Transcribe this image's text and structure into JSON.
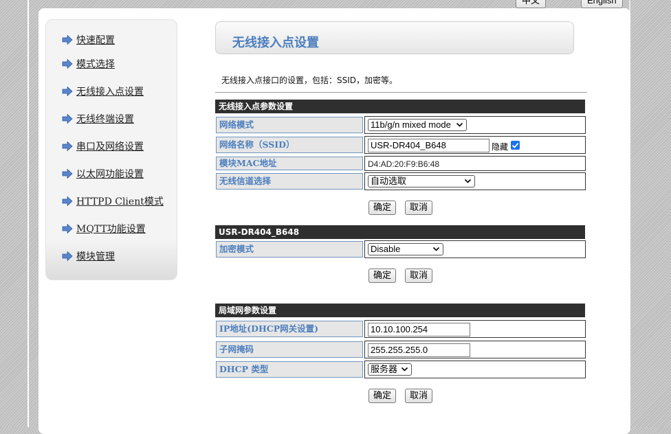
{
  "header": {
    "lang_zh": "中文",
    "lang_en": "English"
  },
  "menu": {
    "items": [
      {
        "label": "快速配置"
      },
      {
        "label": "模式选择"
      },
      {
        "label": "无线接入点设置"
      },
      {
        "label": "无线终端设置"
      },
      {
        "label": "串口及网络设置"
      },
      {
        "label": "以太网功能设置"
      },
      {
        "label": "HTTPD Client模式"
      },
      {
        "label": "MQTT功能设置"
      },
      {
        "label": "模块管理"
      }
    ]
  },
  "page": {
    "title": "无线接入点设置",
    "description": "无线接入点接口的设置，包括：SSID，加密等。"
  },
  "ap_section": {
    "header": "无线接入点参数设置",
    "network_mode": {
      "label": "网络模式",
      "value": "11b/g/n mixed mode"
    },
    "ssid": {
      "label": "网络名称（SSID）",
      "value": "USR-DR404_B648",
      "hide_label": "隐藏",
      "hide_checked": true
    },
    "mac": {
      "label": "模块MAC地址",
      "value": "D4:AD:20:F9:B6:48"
    },
    "channel": {
      "label": "无线信道选择",
      "value": "自动选取"
    },
    "ok": "确定",
    "cancel": "取消"
  },
  "security_section": {
    "header": "USR-DR404_B648",
    "encryption": {
      "label": "加密模式",
      "value": "Disable"
    },
    "ok": "确定",
    "cancel": "取消"
  },
  "lan_section": {
    "header": "局域网参数设置",
    "ip": {
      "label": "IP地址(DHCP网关设置)",
      "value": "10.10.100.254"
    },
    "mask": {
      "label": "子网掩码",
      "value": "255.255.255.0"
    },
    "dhcp": {
      "label": "DHCP 类型",
      "value": "服务器"
    },
    "ok": "确定",
    "cancel": "取消"
  },
  "colors": {
    "accent": "#4d7fbd",
    "section_header": "#2f2f2f",
    "label_bg": "#e6e6e6",
    "checkbox": "#1a73e8"
  }
}
